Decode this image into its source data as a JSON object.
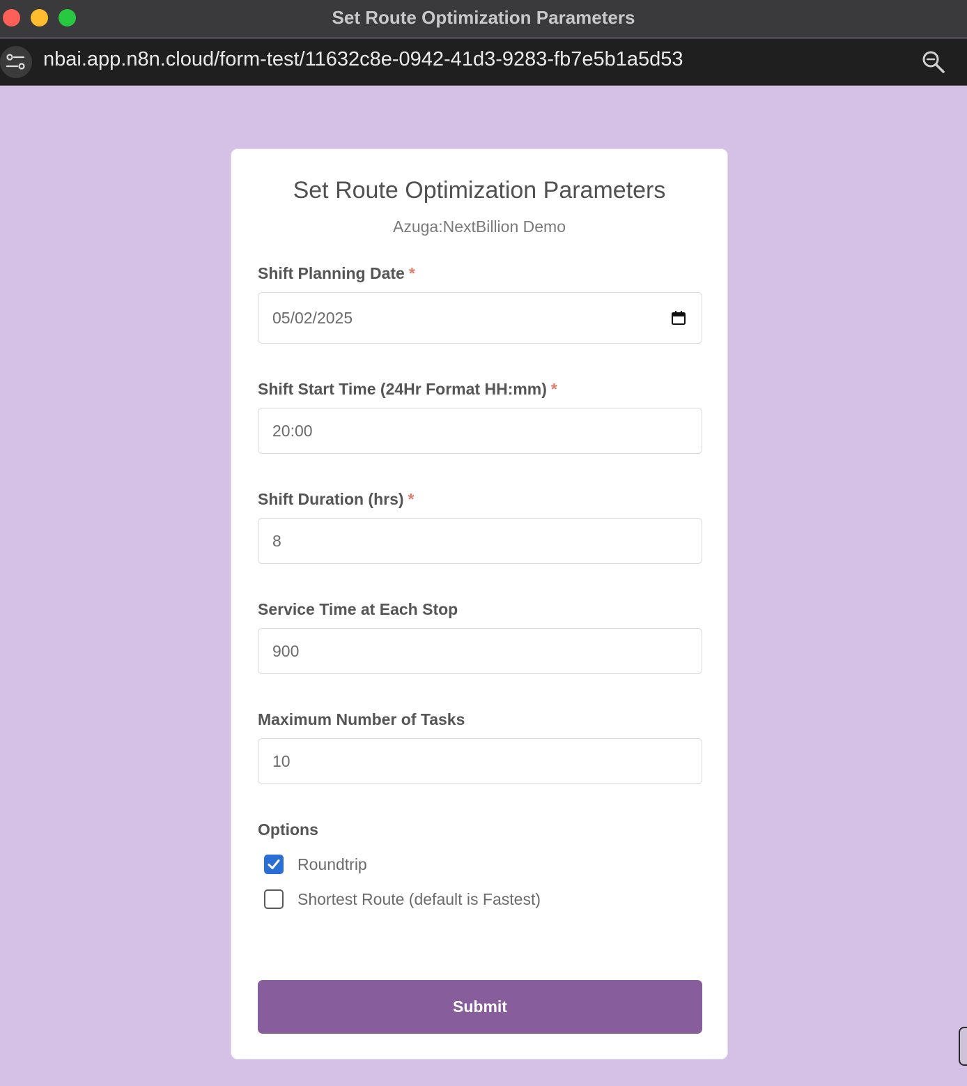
{
  "window": {
    "title": "Set Route Optimization Parameters"
  },
  "browser": {
    "url": "nbai.app.n8n.cloud/form-test/11632c8e-0942-41d3-9283-fb7e5b1a5d53"
  },
  "form": {
    "title": "Set Route Optimization Parameters",
    "subtitle": "Azuga:NextBillion Demo",
    "fields": [
      {
        "label": "Shift Planning Date",
        "required_mark": "*",
        "value": "05/02/2025"
      },
      {
        "label": "Shift Start Time (24Hr Format HH:mm)",
        "required_mark": "*",
        "value": "20:00"
      },
      {
        "label": "Shift Duration (hrs)",
        "required_mark": "*",
        "value": "8"
      },
      {
        "label": "Service Time at Each Stop",
        "value": "900"
      },
      {
        "label": "Maximum Number of Tasks",
        "value": "10"
      }
    ],
    "options_label": "Options",
    "options": [
      {
        "label": "Roundtrip",
        "checked": true
      },
      {
        "label": "Shortest Route (default is Fastest)",
        "checked": false
      }
    ],
    "submit_label": "Submit"
  },
  "colors": {
    "page_background": "#d6c1e6",
    "submit_button": "#875d9b",
    "required_asterisk": "#e07a6a",
    "checkbox_checked": "#2a6fd6"
  }
}
